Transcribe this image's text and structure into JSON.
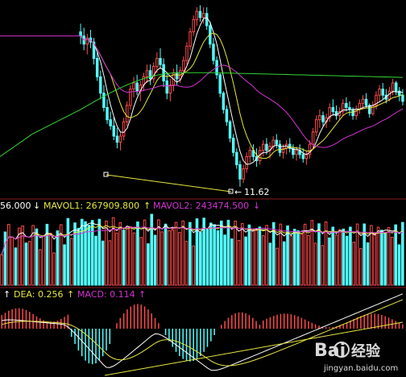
{
  "colors": {
    "background": "#000000",
    "up": "#ff4a4a",
    "down": "#54ffff",
    "ma_short": "#ffffff",
    "ma_mid": "#e6e640",
    "ma_long": "#d233d2",
    "ma_xlong": "#33d633",
    "label_white": "#ffffff",
    "label_yellow": "#e6e640",
    "label_magenta": "#d233d2"
  },
  "price_panel": {
    "low_annotation": "11.62",
    "low_marker_icon": "arrow-left-icon"
  },
  "volume_header": {
    "vol_value": "56.000",
    "vol_arrow": "↓",
    "mavol1_label": "MAVOL1: 267909.800",
    "mavol1_arrow": "↑",
    "mavol2_label": "MAVOL2: 243474.500",
    "mavol2_arrow": "↓"
  },
  "macd_header": {
    "dif_arrow": "↑",
    "dea_label": "DEA: 0.256",
    "dea_arrow": "↑",
    "macd_label": "MACD: 0.114",
    "macd_arrow": "↑"
  },
  "watermark": {
    "brand": "Bai",
    "brand_cn": "经验",
    "url": "jingyan.baidu.com"
  },
  "chart_data": [
    {
      "type": "candlestick",
      "panel": "price",
      "annotations": [
        {
          "text": "11.62",
          "points_to": "period low"
        }
      ],
      "series": [
        {
          "name": "candles",
          "values": [
            [
              19.2,
              19.6,
              18.6,
              19.0
            ],
            [
              19.0,
              19.4,
              18.3,
              18.6
            ],
            [
              18.6,
              19.1,
              18.1,
              18.9
            ],
            [
              18.9,
              19.3,
              18.4,
              18.7
            ],
            [
              18.7,
              18.9,
              17.6,
              17.9
            ],
            [
              17.9,
              18.2,
              16.8,
              17.0
            ],
            [
              17.0,
              17.3,
              15.9,
              16.2
            ],
            [
              16.2,
              16.6,
              15.3,
              15.5
            ],
            [
              15.5,
              15.9,
              14.7,
              14.9
            ],
            [
              14.9,
              15.3,
              14.4,
              14.6
            ],
            [
              14.6,
              15.0,
              13.9,
              14.1
            ],
            [
              14.1,
              14.5,
              13.5,
              13.8
            ],
            [
              13.8,
              14.3,
              13.4,
              14.1
            ],
            [
              14.1,
              15.0,
              13.9,
              14.8
            ],
            [
              14.8,
              15.8,
              14.6,
              15.6
            ],
            [
              15.6,
              16.6,
              15.4,
              16.4
            ],
            [
              16.4,
              17.0,
              16.0,
              16.7
            ],
            [
              16.7,
              17.1,
              16.1,
              16.3
            ],
            [
              16.3,
              16.8,
              15.8,
              16.6
            ],
            [
              16.6,
              17.2,
              16.3,
              17.0
            ],
            [
              17.0,
              17.6,
              16.7,
              17.3
            ],
            [
              17.3,
              17.6,
              16.6,
              16.9
            ],
            [
              16.9,
              17.7,
              16.7,
              17.5
            ],
            [
              17.5,
              18.2,
              17.2,
              17.9
            ],
            [
              17.9,
              18.4,
              17.4,
              17.6
            ],
            [
              17.6,
              17.9,
              16.5,
              16.8
            ],
            [
              16.8,
              17.2,
              15.9,
              16.2
            ],
            [
              16.2,
              16.9,
              15.8,
              16.6
            ],
            [
              16.6,
              17.4,
              16.3,
              17.2
            ],
            [
              17.2,
              17.6,
              16.6,
              16.9
            ],
            [
              16.9,
              17.5,
              16.7,
              17.3
            ],
            [
              17.3,
              18.0,
              17.1,
              17.8
            ],
            [
              17.8,
              18.7,
              17.6,
              18.5
            ],
            [
              18.5,
              19.4,
              18.3,
              19.2
            ],
            [
              19.2,
              20.0,
              19.0,
              19.8
            ],
            [
              19.8,
              20.4,
              19.5,
              20.2
            ],
            [
              20.2,
              20.5,
              19.7,
              19.9
            ],
            [
              19.9,
              20.4,
              19.6,
              20.1
            ],
            [
              20.1,
              20.4,
              19.3,
              19.5
            ],
            [
              19.5,
              19.7,
              18.4,
              18.6
            ],
            [
              18.6,
              18.9,
              17.6,
              17.8
            ],
            [
              17.8,
              18.0,
              16.9,
              17.1
            ],
            [
              17.1,
              17.2,
              16.0,
              16.2
            ],
            [
              16.2,
              16.3,
              15.2,
              15.4
            ],
            [
              15.4,
              15.6,
              14.6,
              14.8
            ],
            [
              14.8,
              14.9,
              13.8,
              14.0
            ],
            [
              14.0,
              14.2,
              13.1,
              13.3
            ],
            [
              13.3,
              13.5,
              12.5,
              12.7
            ],
            [
              12.7,
              12.9,
              11.62,
              12.0
            ],
            [
              12.0,
              12.7,
              11.8,
              12.5
            ],
            [
              12.5,
              13.3,
              12.3,
              13.1
            ],
            [
              13.1,
              13.6,
              12.8,
              13.4
            ],
            [
              13.4,
              13.7,
              12.9,
              13.1
            ],
            [
              13.1,
              13.5,
              12.6,
              12.9
            ],
            [
              12.9,
              13.6,
              12.7,
              13.4
            ],
            [
              13.4,
              13.9,
              13.1,
              13.7
            ],
            [
              13.7,
              14.0,
              13.2,
              13.4
            ],
            [
              13.4,
              13.8,
              13.0,
              13.6
            ],
            [
              13.6,
              14.1,
              13.4,
              13.9
            ],
            [
              13.9,
              14.2,
              13.5,
              13.7
            ],
            [
              13.7,
              13.9,
              13.1,
              13.3
            ],
            [
              13.3,
              13.7,
              13.0,
              13.5
            ],
            [
              13.5,
              13.9,
              13.2,
              13.7
            ],
            [
              13.7,
              14.0,
              13.3,
              13.5
            ],
            [
              13.5,
              13.7,
              13.0,
              13.2
            ],
            [
              13.2,
              13.6,
              12.9,
              13.4
            ],
            [
              13.4,
              13.7,
              13.0,
              13.2
            ],
            [
              13.2,
              13.5,
              12.8,
              13.0
            ],
            [
              13.0,
              13.4,
              12.7,
              13.2
            ],
            [
              13.2,
              13.9,
              13.0,
              13.7
            ],
            [
              13.7,
              14.5,
              13.5,
              14.3
            ],
            [
              14.3,
              15.1,
              14.1,
              14.9
            ],
            [
              14.9,
              15.4,
              14.5,
              15.1
            ],
            [
              15.1,
              15.3,
              14.6,
              14.8
            ],
            [
              14.8,
              15.2,
              14.5,
              15.0
            ],
            [
              15.0,
              15.7,
              14.8,
              15.5
            ],
            [
              15.5,
              15.9,
              15.1,
              15.3
            ],
            [
              15.3,
              15.6,
              14.9,
              15.1
            ],
            [
              15.1,
              15.5,
              14.9,
              15.3
            ],
            [
              15.3,
              15.9,
              15.1,
              15.7
            ],
            [
              15.7,
              16.0,
              15.3,
              15.5
            ],
            [
              15.5,
              15.8,
              15.1,
              15.4
            ],
            [
              15.4,
              15.5,
              14.9,
              15.1
            ],
            [
              15.1,
              15.6,
              14.9,
              15.4
            ],
            [
              15.4,
              15.9,
              15.2,
              15.7
            ],
            [
              15.7,
              16.1,
              15.4,
              15.9
            ],
            [
              15.9,
              16.2,
              15.5,
              15.6
            ],
            [
              15.6,
              15.7,
              15.0,
              15.2
            ],
            [
              15.2,
              15.8,
              15.1,
              15.6
            ],
            [
              15.6,
              16.3,
              15.4,
              16.1
            ],
            [
              16.1,
              16.6,
              15.8,
              16.4
            ],
            [
              16.4,
              16.7,
              15.9,
              16.1
            ],
            [
              16.1,
              16.4,
              15.7,
              15.9
            ],
            [
              15.9,
              16.5,
              15.8,
              16.3
            ],
            [
              16.3,
              16.9,
              16.1,
              16.7
            ],
            [
              16.7,
              16.8,
              16.1,
              16.3
            ],
            [
              16.3,
              16.5,
              15.8,
              16.1
            ],
            [
              16.1,
              16.4,
              15.6,
              15.8
            ]
          ]
        }
      ]
    },
    {
      "type": "bar",
      "panel": "volume",
      "series": [
        {
          "name": "MAVOL1",
          "values": [
            267909.8
          ]
        },
        {
          "name": "MAVOL2",
          "values": [
            243474.5
          ]
        }
      ]
    },
    {
      "type": "bar",
      "panel": "macd",
      "series": [
        {
          "name": "DEA",
          "values": [
            0.256
          ]
        },
        {
          "name": "MACD",
          "values": [
            0.114
          ]
        }
      ]
    }
  ]
}
